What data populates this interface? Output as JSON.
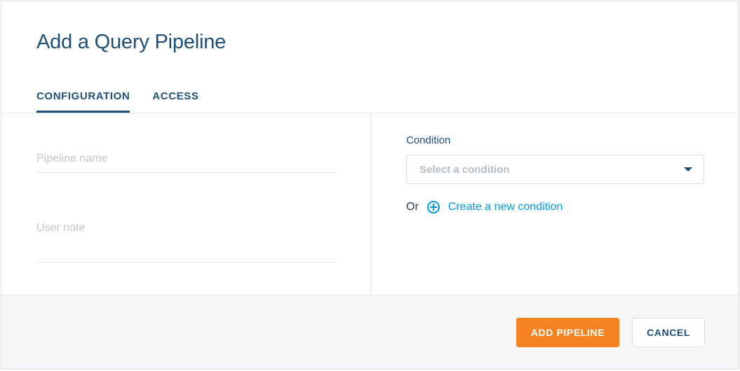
{
  "header": {
    "title": "Add a Query Pipeline"
  },
  "tabs": {
    "configuration": "CONFIGURATION",
    "access": "ACCESS"
  },
  "form": {
    "pipeline_name_placeholder": "Pipeline name",
    "pipeline_name_value": "",
    "user_note_placeholder": "User note",
    "user_note_value": ""
  },
  "condition": {
    "label": "Condition",
    "select_placeholder": "Select a condition",
    "or_text": "Or",
    "create_link": "Create a new condition"
  },
  "footer": {
    "add_label": "ADD PIPELINE",
    "cancel_label": "CANCEL"
  }
}
